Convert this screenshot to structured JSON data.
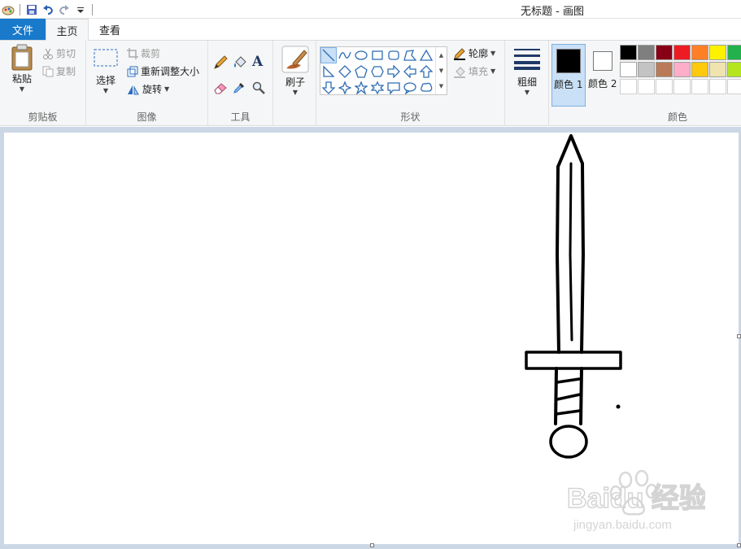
{
  "window": {
    "title": "无标题 - 画图"
  },
  "tabs": {
    "file": "文件",
    "home": "主页",
    "view": "查看"
  },
  "clipboard": {
    "paste": "粘贴",
    "cut": "剪切",
    "copy": "复制",
    "group_label": "剪贴板"
  },
  "image": {
    "select": "选择",
    "crop": "裁剪",
    "resize": "重新调整大小",
    "rotate": "旋转",
    "group_label": "图像"
  },
  "tools": {
    "group_label": "工具"
  },
  "brushes": {
    "label": "刷子"
  },
  "shapes": {
    "outline": "轮廓",
    "fill": "填充",
    "group_label": "形状"
  },
  "size": {
    "label": "粗细"
  },
  "colors": {
    "color1_label": "颜色 1",
    "color2_label": "颜色 2",
    "group_label": "颜色",
    "color1": "#000000",
    "color2": "#ffffff",
    "palette_row1": [
      "#000000",
      "#7f7f7f",
      "#880015",
      "#ed1c24",
      "#ff7f27",
      "#fff200",
      "#22b14c"
    ],
    "palette_row2": [
      "#ffffff",
      "#c3c3c3",
      "#b97a57",
      "#ffaec9",
      "#ffc90e",
      "#efe4b0",
      "#b5e61d"
    ]
  },
  "watermark": {
    "brand": "Baidu 经验",
    "url": "jingyan.baidu.com"
  }
}
